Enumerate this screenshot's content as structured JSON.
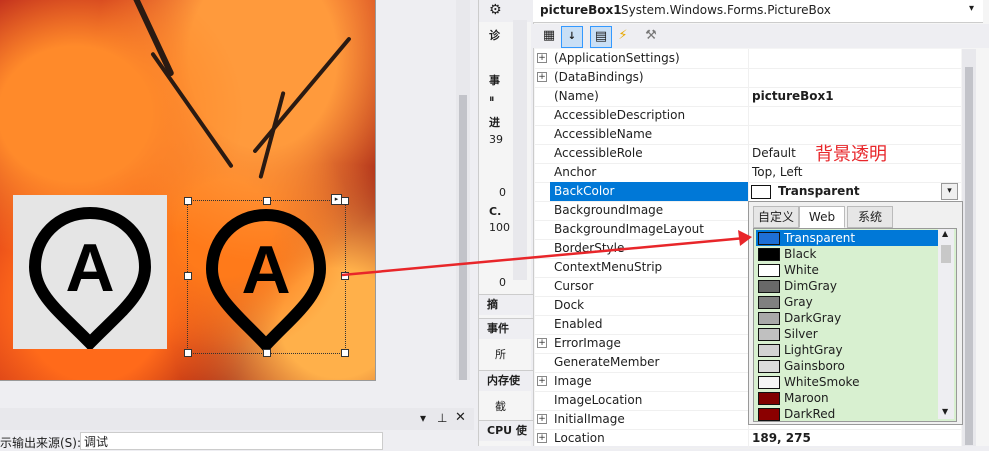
{
  "properties_panel": {
    "object_name": "pictureBox1",
    "object_type": "System.Windows.Forms.PictureBox",
    "rows": [
      {
        "name": "(ApplicationSettings)",
        "value": "",
        "expander": "+"
      },
      {
        "name": "(DataBindings)",
        "value": "",
        "expander": "+"
      },
      {
        "name": "(Name)",
        "value": "pictureBox1",
        "expander": "",
        "bold": true
      },
      {
        "name": "AccessibleDescription",
        "value": "",
        "expander": ""
      },
      {
        "name": "AccessibleName",
        "value": "",
        "expander": ""
      },
      {
        "name": "AccessibleRole",
        "value": "Default",
        "expander": ""
      },
      {
        "name": "Anchor",
        "value": "Top, Left",
        "expander": ""
      },
      {
        "name": "BackColor",
        "value": "Transparent",
        "expander": "",
        "bold": true
      },
      {
        "name": "BackgroundImage",
        "value": "",
        "expander": ""
      },
      {
        "name": "BackgroundImageLayout",
        "value": "",
        "expander": ""
      },
      {
        "name": "BorderStyle",
        "value": "",
        "expander": ""
      },
      {
        "name": "ContextMenuStrip",
        "value": "",
        "expander": ""
      },
      {
        "name": "Cursor",
        "value": "",
        "expander": ""
      },
      {
        "name": "Dock",
        "value": "",
        "expander": ""
      },
      {
        "name": "Enabled",
        "value": "",
        "expander": ""
      },
      {
        "name": "ErrorImage",
        "value": "",
        "expander": "+"
      },
      {
        "name": "GenerateMember",
        "value": "",
        "expander": ""
      },
      {
        "name": "Image",
        "value": "",
        "expander": "+"
      },
      {
        "name": "ImageLocation",
        "value": "",
        "expander": ""
      },
      {
        "name": "InitialImage",
        "value": "",
        "expander": "+"
      },
      {
        "name": "Location",
        "value": "189, 275",
        "expander": "+",
        "bold": true
      }
    ]
  },
  "color_dropdown": {
    "tabs": [
      "自定义",
      "Web",
      "系统"
    ],
    "active_tab": "Web",
    "colors": [
      {
        "name": "Transparent",
        "hex": "#1e6fd6"
      },
      {
        "name": "Black",
        "hex": "#000000"
      },
      {
        "name": "White",
        "hex": "#ffffff"
      },
      {
        "name": "DimGray",
        "hex": "#696969"
      },
      {
        "name": "Gray",
        "hex": "#808080"
      },
      {
        "name": "DarkGray",
        "hex": "#a9a9a9"
      },
      {
        "name": "Silver",
        "hex": "#c0c0c0"
      },
      {
        "name": "LightGray",
        "hex": "#d3d3d3"
      },
      {
        "name": "Gainsboro",
        "hex": "#dcdcdc"
      },
      {
        "name": "WhiteSmoke",
        "hex": "#f5f5f5"
      },
      {
        "name": "Maroon",
        "hex": "#800000"
      },
      {
        "name": "DarkRed",
        "hex": "#8b0000"
      }
    ],
    "selected": "Transparent"
  },
  "annotation": "背景透明",
  "diagnostics": {
    "top_label": "诊",
    "items": [
      "事",
      "进",
      "39",
      "0",
      "C.",
      "100",
      "0"
    ],
    "tabs": [
      "摘",
      "事件",
      "所",
      "内存使",
      "截",
      "CPU 使"
    ]
  },
  "picture_letter": "A",
  "output": {
    "source_label": "示输出来源(S):",
    "source_value": "调试"
  },
  "colors": {
    "accent": "#0078d7",
    "annotation": "#e8262a"
  }
}
